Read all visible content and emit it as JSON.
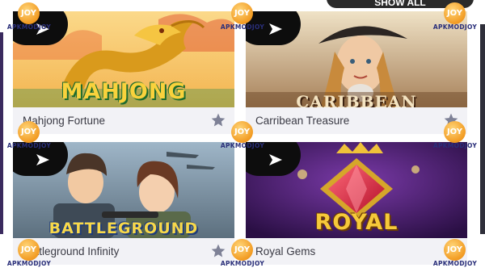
{
  "header": {
    "show_all_label": "SHOW ALL"
  },
  "games": [
    {
      "title": "Mahjong Fortune",
      "logo": "MAHJONG",
      "theme": "dragon"
    },
    {
      "title": "Carribean Treasure",
      "logo": "CARIBBEAN",
      "theme": "pirate"
    },
    {
      "title": "Battleground Infinity",
      "logo": "BATTLEGROUND",
      "theme": "soldiers"
    },
    {
      "title": "Royal Gems",
      "logo": "ROYAL",
      "theme": "gems"
    }
  ],
  "watermark": {
    "badge": "JOY",
    "text": "APKMODJOY"
  },
  "icons": {
    "play": "play-icon",
    "favorite": "star-icon",
    "watermark": "coin-logo"
  },
  "colors": {
    "caption_bg": "#f2f2f6",
    "title_text": "#3a3a44",
    "star": "#7e8196",
    "watermark_orange": "#f29b22",
    "watermark_text": "#2a2f7a"
  }
}
